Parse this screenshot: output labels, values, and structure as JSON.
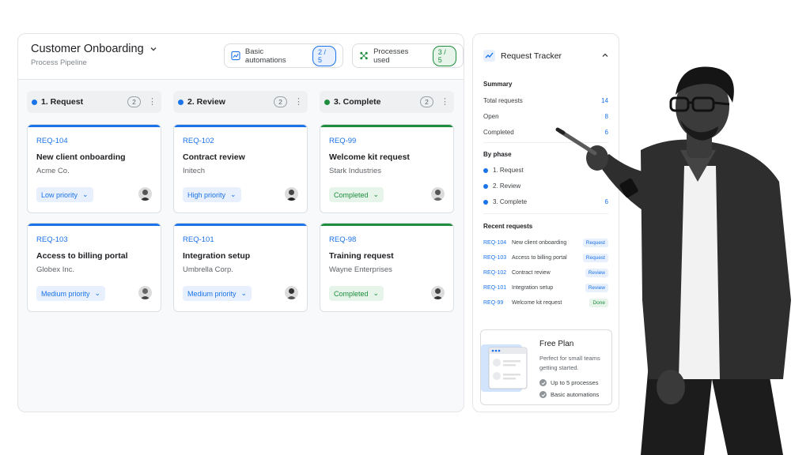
{
  "pipeline": {
    "title": "Customer Onboarding",
    "subtitle": "Process Pipeline",
    "stats": [
      {
        "label": "Basic automations",
        "value": "2 / 5",
        "icon": "chart-icon"
      },
      {
        "label": "Processes used",
        "value": "3 / 5",
        "icon": "workflow-icon"
      }
    ],
    "columns": [
      {
        "title": "1. Request",
        "count": "2",
        "color": "#1a73e8",
        "cards": [
          {
            "id": "REQ-104",
            "title": "New client onboarding",
            "company": "Acme Co.",
            "tag": "Low priority"
          },
          {
            "id": "REQ-103",
            "title": "Access to billing portal",
            "company": "Globex Inc.",
            "tag": "Medium priority"
          }
        ]
      },
      {
        "title": "2. Review",
        "count": "2",
        "color": "#1a73e8",
        "cards": [
          {
            "id": "REQ-102",
            "title": "Contract review",
            "company": "Initech",
            "tag": "High priority"
          },
          {
            "id": "REQ-101",
            "title": "Integration setup",
            "company": "Umbrella Corp.",
            "tag": "Medium priority"
          }
        ]
      },
      {
        "title": "3. Complete",
        "count": "2",
        "color": "#1e8e3e",
        "cards": [
          {
            "id": "REQ-99",
            "title": "Welcome kit request",
            "company": "Stark Industries",
            "tag": "Completed"
          },
          {
            "id": "REQ-98",
            "title": "Training request",
            "company": "Wayne Enterprises",
            "tag": "Completed"
          }
        ]
      }
    ]
  },
  "tracker": {
    "title": "Request Tracker",
    "summary_label": "Summary",
    "summary": [
      {
        "label": "Total requests",
        "value": "14"
      },
      {
        "label": "Open",
        "value": "8"
      },
      {
        "label": "Completed",
        "value": "6"
      }
    ],
    "phase_label": "By phase",
    "phases": [
      {
        "label": "1. Request",
        "value": ""
      },
      {
        "label": "2. Review",
        "value": ""
      },
      {
        "label": "3. Complete",
        "value": "6"
      }
    ],
    "recent_label": "Recent requests",
    "recent": [
      {
        "id": "REQ-104",
        "name": "New client onboarding",
        "tag": "Request"
      },
      {
        "id": "REQ-103",
        "name": "Access to billing portal",
        "tag": "Request"
      },
      {
        "id": "REQ-102",
        "name": "Contract review",
        "tag": "Review"
      },
      {
        "id": "REQ-101",
        "name": "Integration setup",
        "tag": "Review"
      },
      {
        "id": "REQ-99",
        "name": "Welcome kit request",
        "tag": "Done"
      }
    ],
    "plan": {
      "title": "Free Plan",
      "description": "Perfect for small teams getting started.",
      "features": [
        "Up to 5 processes",
        "Basic automations"
      ]
    }
  },
  "colors": {
    "accent": "#1a73e8",
    "success": "#1e8e3e"
  }
}
